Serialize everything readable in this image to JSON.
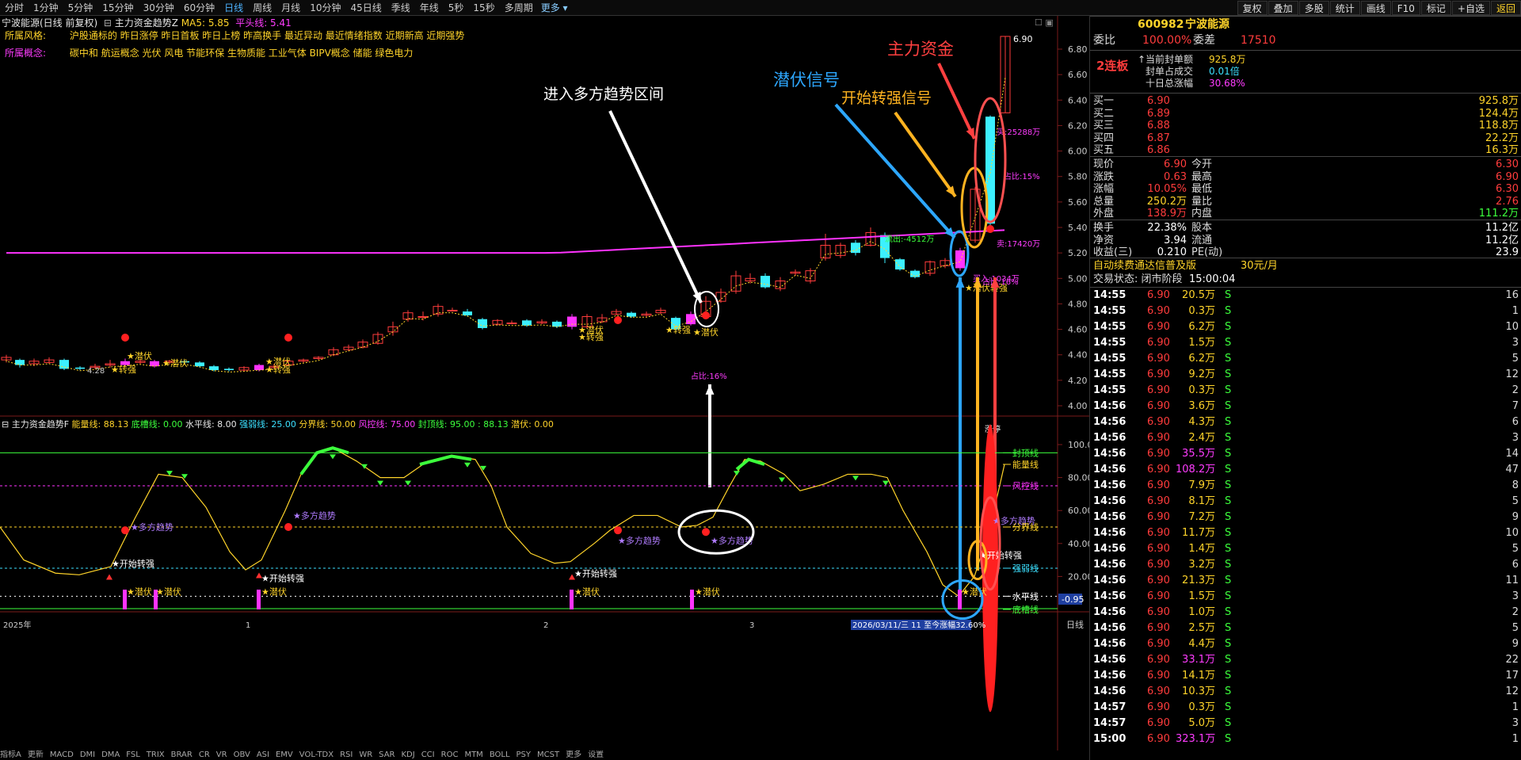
{
  "toolbar": {
    "timeframes": [
      "分时",
      "1分钟",
      "5分钟",
      "15分钟",
      "30分钟",
      "60分钟",
      "日线",
      "周线",
      "月线",
      "10分钟",
      "45日线",
      "季线",
      "年线",
      "5秒",
      "15秒",
      "多周期",
      "更多"
    ],
    "active": "日线",
    "right_buttons": [
      "复权",
      "叠加",
      "多股",
      "统计",
      "画线",
      "F10",
      "标记",
      "+自选",
      "返回"
    ]
  },
  "chart_header": {
    "stock": "宁波能源(日线 前复权)",
    "indicator": "主力资金趋势Z",
    "ma5": "MA5: 5.85",
    "pingtou": "平头线: 5.41",
    "style_label": "所属风格:",
    "style_text": "沪股通标的 昨日涨停 昨日首板 昨日上榜 昨高换手 最近异动 最近情绪指数 近期新高 近期强势",
    "concept_label": "所属概念:",
    "concept_text": "碳中和 航运概念 光伏 风电 节能环保 生物质能 工业气体 BIPV概念 储能 绿色电力"
  },
  "annotations": {
    "enter_zone": "进入多方趋势区间",
    "lurk_signal": "潜伏信号",
    "strong_signal": "开始转强信号",
    "main_money": "主力资金"
  },
  "main_labels": {
    "high_price": "6.90",
    "low_price": "4.28",
    "buy_label": "买:25288万",
    "ratio15": "占比:15%",
    "ratio16": "占比:16%",
    "sell_label": "卖:17420万",
    "outflow": "流出:-4512万",
    "buy2": "买入:1034万",
    "ratio_right": "占比:16%",
    "lurk": "★潜伏",
    "strong": "★转强",
    "lurk_strong": "★潜伏转强",
    "limit_up": "涨停"
  },
  "price_axis": [
    "6.80",
    "6.60",
    "6.40",
    "6.20",
    "6.00",
    "5.80",
    "5.60",
    "5.40",
    "5.20",
    "5.00",
    "4.80",
    "4.60",
    "4.40",
    "4.20",
    "4.00"
  ],
  "sub_header": {
    "name": "主力资金趋势F",
    "energy": "能量线: 88.13",
    "bottom": "底槽线: 0.00",
    "level": "水平线: 8.00",
    "weak": "强弱线: 25.00",
    "divider": "分界线: 50.00",
    "risk": "风控线: 75.00",
    "top": "封顶线: 95.00 : 88.13",
    "lurk": "潜伏: 0.00"
  },
  "sub_axis": [
    "100.0",
    "80.00",
    "60.00",
    "40.00",
    "20.00"
  ],
  "sub_right_labels": {
    "top": "封顶线",
    "energy": "能量线",
    "risk": "风控线",
    "divider": "分界线",
    "weak": "强弱线",
    "level": "水平线",
    "bottom": "底槽线",
    "val": "-0.95"
  },
  "sub_signals": {
    "bull": "★多方趋势",
    "strong": "★开始转强",
    "lurk": "★潜伏"
  },
  "x_axis": {
    "year": "2025年",
    "m1": "1",
    "m2": "2",
    "m3": "3",
    "range": "2026/03/11/三 11 至今涨幅32.60%"
  },
  "bottom_tabs": [
    "指标A",
    "更新",
    "MACD",
    "DMI",
    "DMA",
    "FSL",
    "TRIX",
    "BRAR",
    "CR",
    "VR",
    "OBV",
    "ASI",
    "EMV",
    "VOL-TDX",
    "RSI",
    "WR",
    "SAR",
    "KDJ",
    "CCI",
    "ROC",
    "MTM",
    "BOLL",
    "PSY",
    "MCST",
    "更多",
    "设置"
  ],
  "bottom_right": "日线",
  "panel": {
    "code": "600982",
    "name": "宁波能源",
    "weibi_label": "委比",
    "weibi_val": "100.00%",
    "weicha_label": "委差",
    "weicha_val": "17510",
    "board": "2连板",
    "fd1_label": "当前封单额",
    "fd1_val": "925.8万",
    "fd2_label": "封单占成交",
    "fd2_val": "0.01倍",
    "fd3_label": "十日总涨幅",
    "fd3_val": "30.68%",
    "bids": [
      {
        "label": "买一",
        "price": "6.90",
        "vol": "925.8万"
      },
      {
        "label": "买二",
        "price": "6.89",
        "vol": "124.4万"
      },
      {
        "label": "买三",
        "price": "6.88",
        "vol": "118.8万"
      },
      {
        "label": "买四",
        "price": "6.87",
        "vol": "22.2万"
      },
      {
        "label": "买五",
        "price": "6.86",
        "vol": "16.3万"
      }
    ],
    "quote": [
      {
        "l1": "现价",
        "v1": "6.90",
        "l2": "今开",
        "v2": "6.30",
        "c1": "red",
        "c2": "red"
      },
      {
        "l1": "涨跌",
        "v1": "0.63",
        "l2": "最高",
        "v2": "6.90",
        "c1": "red",
        "c2": "red"
      },
      {
        "l1": "涨幅",
        "v1": "10.05%",
        "l2": "最低",
        "v2": "6.30",
        "c1": "red",
        "c2": "red"
      },
      {
        "l1": "总量",
        "v1": "250.2万",
        "l2": "量比",
        "v2": "2.76",
        "c1": "yellow",
        "c2": "red"
      },
      {
        "l1": "外盘",
        "v1": "138.9万",
        "l2": "内盘",
        "v2": "111.2万",
        "c1": "red",
        "c2": "green"
      }
    ],
    "fund": [
      {
        "l1": "换手",
        "v1": "22.38%",
        "l2": "股本",
        "v2": "11.2亿"
      },
      {
        "l1": "净资",
        "v1": "3.94",
        "l2": "流通",
        "v2": "11.2亿"
      },
      {
        "l1": "收益(三)",
        "v1": "0.210",
        "l2": "PE(动)",
        "v2": "23.9"
      }
    ],
    "ad": "自动续费通达信普及版",
    "ad_price": "30元/月",
    "status": "交易状态: 闭市阶段",
    "status_time": "15:00:04",
    "ticks": [
      {
        "t": "14:55",
        "p": "6.90",
        "v": "20.5万",
        "s": "S",
        "n": "16"
      },
      {
        "t": "14:55",
        "p": "6.90",
        "v": "0.3万",
        "s": "S",
        "n": "1"
      },
      {
        "t": "14:55",
        "p": "6.90",
        "v": "6.2万",
        "s": "S",
        "n": "10"
      },
      {
        "t": "14:55",
        "p": "6.90",
        "v": "1.5万",
        "s": "S",
        "n": "3"
      },
      {
        "t": "14:55",
        "p": "6.90",
        "v": "6.2万",
        "s": "S",
        "n": "5"
      },
      {
        "t": "14:55",
        "p": "6.90",
        "v": "9.2万",
        "s": "S",
        "n": "12"
      },
      {
        "t": "14:55",
        "p": "6.90",
        "v": "0.3万",
        "s": "S",
        "n": "2"
      },
      {
        "t": "14:56",
        "p": "6.90",
        "v": "3.6万",
        "s": "S",
        "n": "7"
      },
      {
        "t": "14:56",
        "p": "6.90",
        "v": "4.3万",
        "s": "S",
        "n": "6"
      },
      {
        "t": "14:56",
        "p": "6.90",
        "v": "2.4万",
        "s": "S",
        "n": "3"
      },
      {
        "t": "14:56",
        "p": "6.90",
        "v": "35.5万",
        "s": "S",
        "n": "14"
      },
      {
        "t": "14:56",
        "p": "6.90",
        "v": "108.2万",
        "s": "S",
        "n": "47"
      },
      {
        "t": "14:56",
        "p": "6.90",
        "v": "7.9万",
        "s": "S",
        "n": "8"
      },
      {
        "t": "14:56",
        "p": "6.90",
        "v": "8.1万",
        "s": "S",
        "n": "5"
      },
      {
        "t": "14:56",
        "p": "6.90",
        "v": "7.2万",
        "s": "S",
        "n": "9"
      },
      {
        "t": "14:56",
        "p": "6.90",
        "v": "11.7万",
        "s": "S",
        "n": "10"
      },
      {
        "t": "14:56",
        "p": "6.90",
        "v": "1.4万",
        "s": "S",
        "n": "5"
      },
      {
        "t": "14:56",
        "p": "6.90",
        "v": "3.2万",
        "s": "S",
        "n": "6"
      },
      {
        "t": "14:56",
        "p": "6.90",
        "v": "21.3万",
        "s": "S",
        "n": "11"
      },
      {
        "t": "14:56",
        "p": "6.90",
        "v": "1.5万",
        "s": "S",
        "n": "3"
      },
      {
        "t": "14:56",
        "p": "6.90",
        "v": "1.0万",
        "s": "S",
        "n": "2"
      },
      {
        "t": "14:56",
        "p": "6.90",
        "v": "2.5万",
        "s": "S",
        "n": "5"
      },
      {
        "t": "14:56",
        "p": "6.90",
        "v": "4.4万",
        "s": "S",
        "n": "9"
      },
      {
        "t": "14:56",
        "p": "6.90",
        "v": "33.1万",
        "s": "S",
        "n": "22"
      },
      {
        "t": "14:56",
        "p": "6.90",
        "v": "14.1万",
        "s": "S",
        "n": "17"
      },
      {
        "t": "14:56",
        "p": "6.90",
        "v": "10.3万",
        "s": "S",
        "n": "12"
      },
      {
        "t": "14:57",
        "p": "6.90",
        "v": "0.3万",
        "s": "S",
        "n": "1"
      },
      {
        "t": "14:57",
        "p": "6.90",
        "v": "5.0万",
        "s": "S",
        "n": "3"
      },
      {
        "t": "15:00",
        "p": "6.90",
        "v": "323.1万",
        "s": "S",
        "n": "1"
      }
    ]
  },
  "colors": {
    "up": "#ff3c3c",
    "down": "#3cf0ff",
    "ma": "#ff33ff",
    "yellow": "#ffd42a",
    "grid": "#7a1a1a"
  }
}
